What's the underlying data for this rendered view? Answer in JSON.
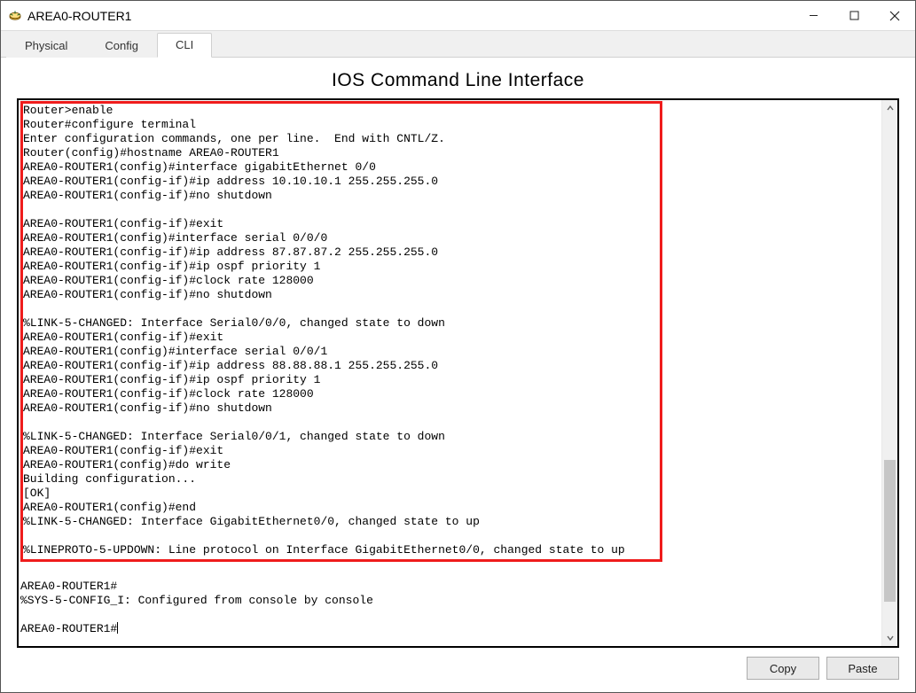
{
  "window": {
    "title": "AREA0-ROUTER1"
  },
  "tabs": {
    "physical": "Physical",
    "config": "Config",
    "cli": "CLI"
  },
  "heading": "IOS Command Line Interface",
  "cli": {
    "highlighted": "Router>enable\nRouter#configure terminal\nEnter configuration commands, one per line.  End with CNTL/Z.\nRouter(config)#hostname AREA0-ROUTER1\nAREA0-ROUTER1(config)#interface gigabitEthernet 0/0\nAREA0-ROUTER1(config-if)#ip address 10.10.10.1 255.255.255.0\nAREA0-ROUTER1(config-if)#no shutdown\n\nAREA0-ROUTER1(config-if)#exit\nAREA0-ROUTER1(config)#interface serial 0/0/0\nAREA0-ROUTER1(config-if)#ip address 87.87.87.2 255.255.255.0\nAREA0-ROUTER1(config-if)#ip ospf priority 1\nAREA0-ROUTER1(config-if)#clock rate 128000\nAREA0-ROUTER1(config-if)#no shutdown\n\n%LINK-5-CHANGED: Interface Serial0/0/0, changed state to down\nAREA0-ROUTER1(config-if)#exit\nAREA0-ROUTER1(config)#interface serial 0/0/1\nAREA0-ROUTER1(config-if)#ip address 88.88.88.1 255.255.255.0\nAREA0-ROUTER1(config-if)#ip ospf priority 1\nAREA0-ROUTER1(config-if)#clock rate 128000\nAREA0-ROUTER1(config-if)#no shutdown\n\n%LINK-5-CHANGED: Interface Serial0/0/1, changed state to down\nAREA0-ROUTER1(config-if)#exit\nAREA0-ROUTER1(config)#do write\nBuilding configuration...\n[OK]\nAREA0-ROUTER1(config)#end\n%LINK-5-CHANGED: Interface GigabitEthernet0/0, changed state to up\n\n%LINEPROTO-5-UPDOWN: Line protocol on Interface GigabitEthernet0/0, changed state to up",
    "rest": "\nAREA0-ROUTER1#\n%SYS-5-CONFIG_I: Configured from console by console\n\nAREA0-ROUTER1#"
  },
  "buttons": {
    "copy": "Copy",
    "paste": "Paste"
  }
}
